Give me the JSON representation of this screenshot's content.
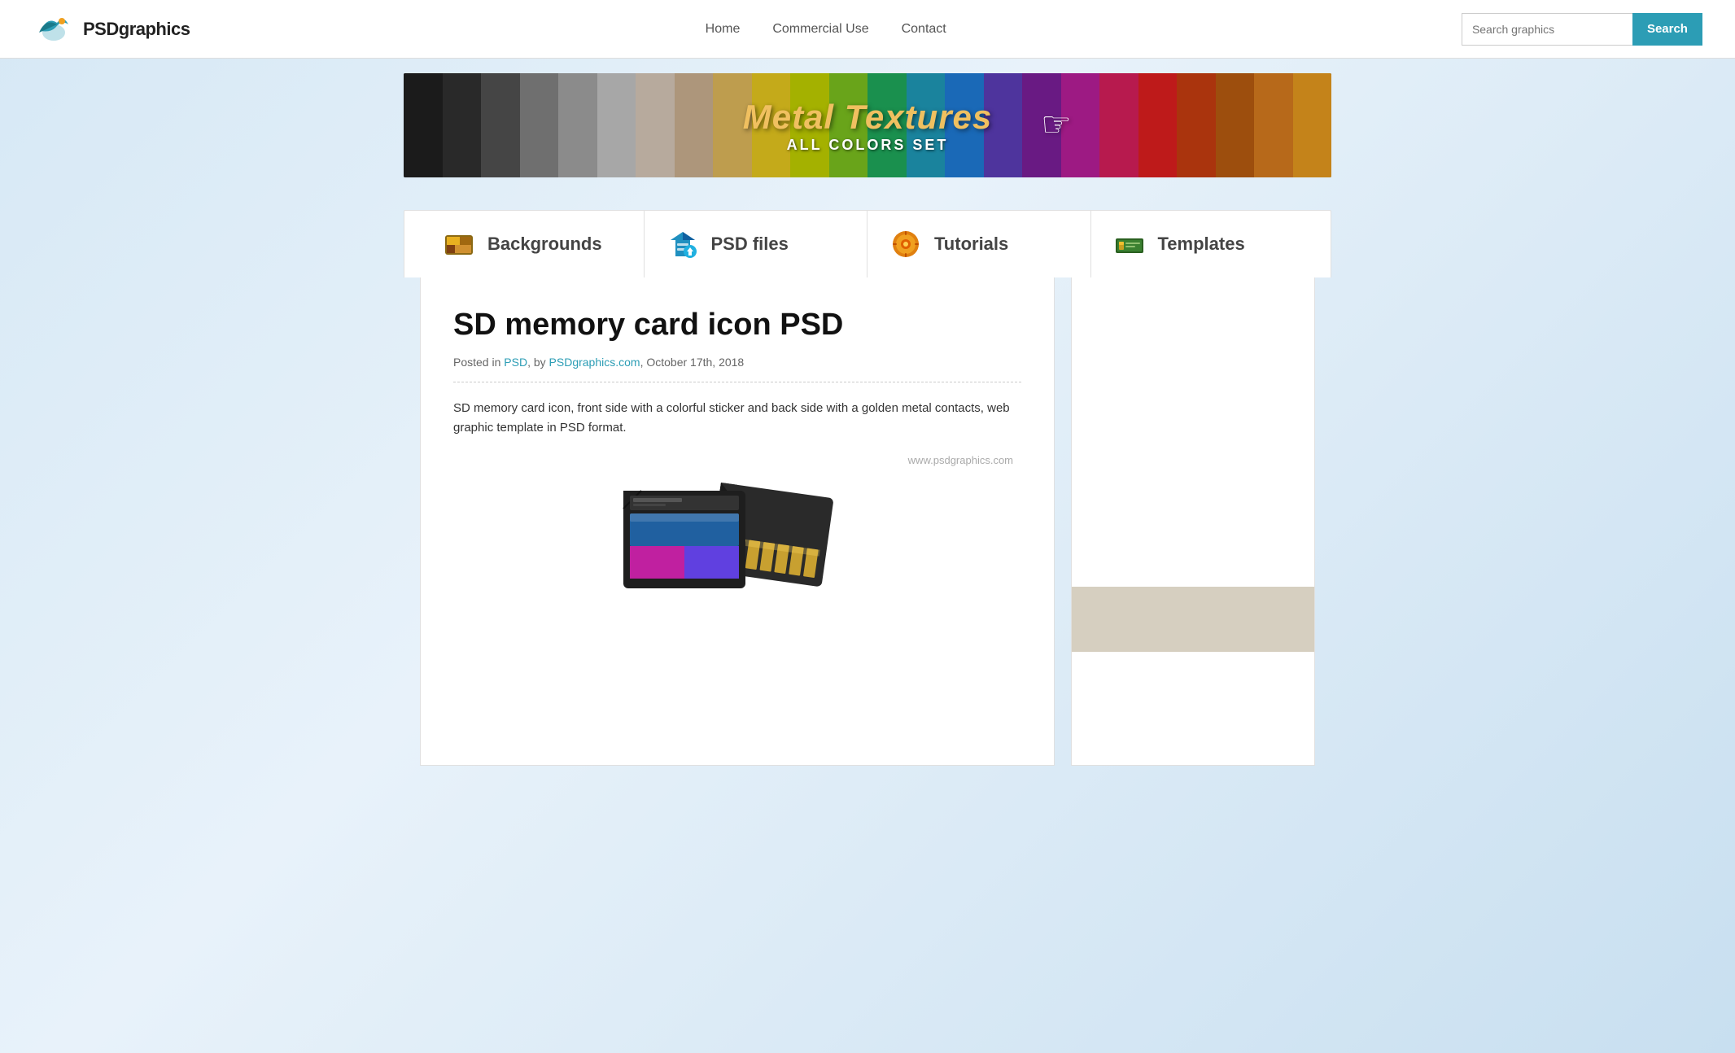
{
  "header": {
    "logo_text_psd": "PSD",
    "logo_text_graphics": "graphics",
    "nav": {
      "home": "Home",
      "commercial_use": "Commercial Use",
      "contact": "Contact"
    },
    "search": {
      "placeholder": "Search graphics",
      "button_label": "Search"
    }
  },
  "banner": {
    "title": "Metal Textures",
    "subtitle": "ALL COLORS SET"
  },
  "categories": [
    {
      "id": "backgrounds",
      "label": "Backgrounds",
      "icon": "🎨"
    },
    {
      "id": "psd-files",
      "label": "PSD files",
      "icon": "🧩"
    },
    {
      "id": "tutorials",
      "label": "Tutorials",
      "icon": "⚙️"
    },
    {
      "id": "templates",
      "label": "Templates",
      "icon": "💵"
    }
  ],
  "article": {
    "title": "SD memory card icon PSD",
    "meta_prefix": "Posted in",
    "meta_category": "PSD",
    "meta_by": "by",
    "meta_author": "PSDgraphics.com",
    "meta_date": "October 17th, 2018",
    "description": "SD memory card icon, front side with a colorful sticker and back side with a golden metal contacts, web graphic template in PSD format.",
    "watermark": "www.psdgraphics.com"
  },
  "colors": {
    "accent": "#2c9db5",
    "banner_text": "#f0c060",
    "bg_light": "#d6e8f5"
  }
}
